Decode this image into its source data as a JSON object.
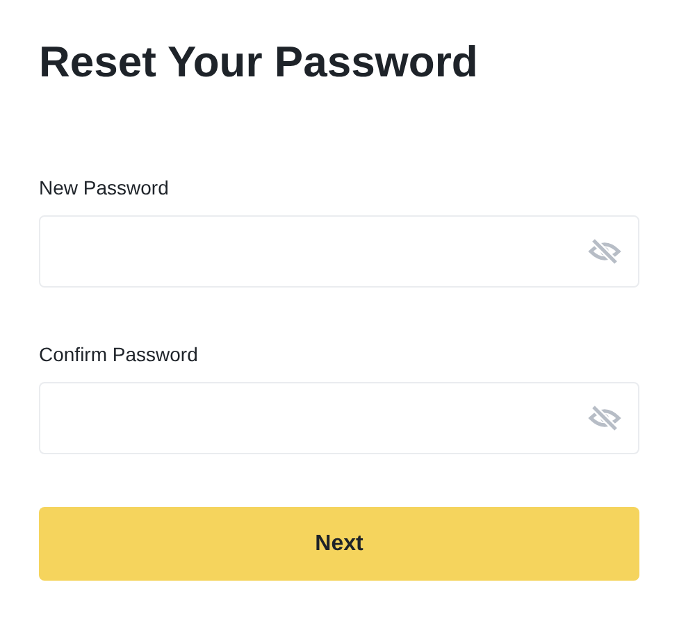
{
  "title": "Reset Your Password",
  "fields": [
    {
      "label": "New Password",
      "masked": true
    },
    {
      "label": "Confirm Password",
      "masked": true
    }
  ],
  "button": "Next"
}
